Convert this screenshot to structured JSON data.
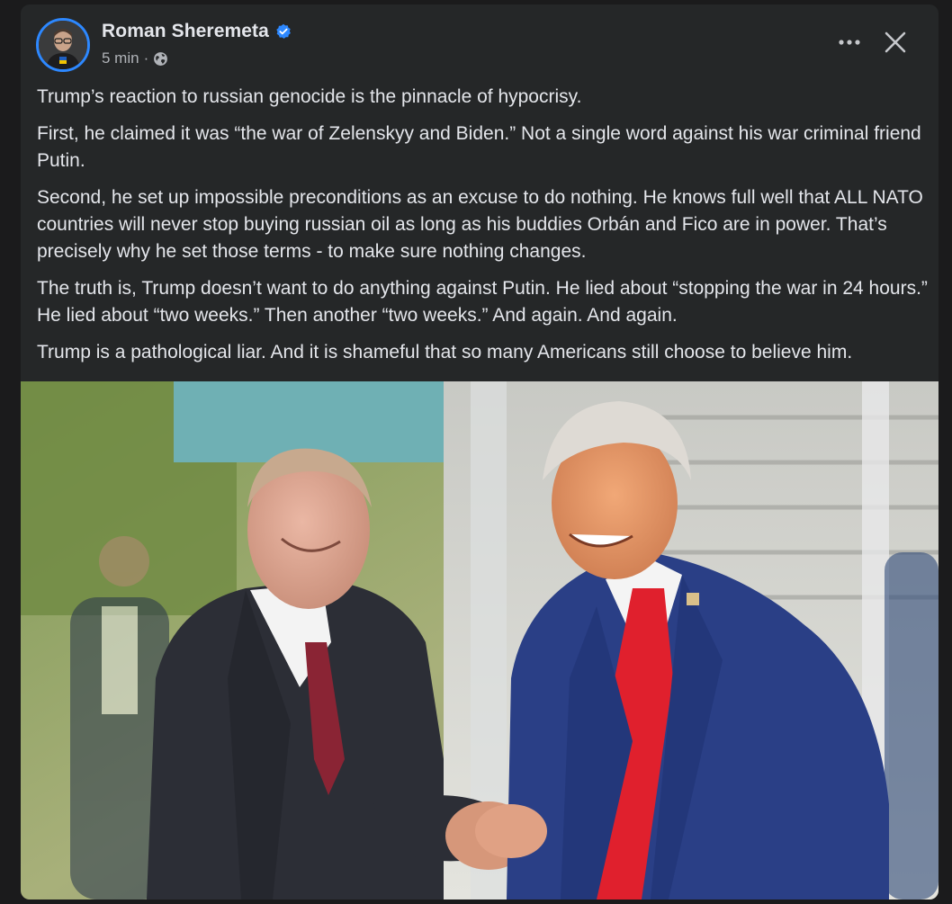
{
  "post": {
    "author": {
      "name": "Roman Sheremeta",
      "verified": true,
      "avatar_ring_color": "#2d88ff"
    },
    "time": "5 min",
    "separator": "·",
    "audience_icon": "globe-icon",
    "actions": {
      "more_icon": "more-horizontal-icon",
      "close_icon": "close-icon"
    },
    "paragraphs": [
      "Trump’s reaction to russian genocide is the pinnacle of hypocrisy.",
      "First, he claimed it was “the war of Zelenskyy and Biden.” Not a single word against his war criminal friend Putin.",
      "Second, he set up impossible preconditions as an excuse to do nothing. He knows full well that ALL NATO countries will never stop buying russian oil as long as his buddies Orbán and Fico are in power. That’s precisely why he set those terms - to make sure nothing changes.",
      "The truth is, Trump doesn’t want to do anything against Putin. He lied about “stopping the war in 24 hours.” He lied about “two weeks.” Then another “two weeks.” And again. And again.",
      "Trump is a pathological liar. And it is shameful that so many Americans still choose to believe him."
    ]
  },
  "colors": {
    "card_bg": "#252728",
    "text_primary": "#e4e6eb",
    "text_secondary": "#b0b3b8",
    "verified_blue": "#2d88ff"
  }
}
